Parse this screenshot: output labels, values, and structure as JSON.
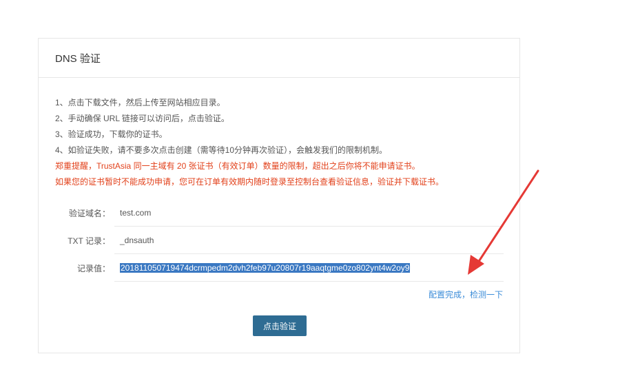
{
  "card": {
    "title": "DNS 验证",
    "instructions": [
      "1、点击下载文件，然后上传至网站相应目录。",
      "2、手动确保 URL 链接可以访问后，点击验证。",
      "3、验证成功，下载你的证书。",
      "4、如验证失败，请不要多次点击创建（需等待10分钟再次验证），会触发我们的限制机制。"
    ],
    "warnings": [
      "郑重提醒，TrustAsia 同一主域有 20 张证书（有效订单）数量的限制，超出之后你将不能申请证书。",
      "如果您的证书暂时不能成功申请，您可在订单有效期内随时登录至控制台查看验证信息，验证并下载证书。"
    ],
    "fields": {
      "domain_label": "验证域名：",
      "domain_value": "test.com",
      "txt_label": "TXT 记录：",
      "txt_value": "_dnsauth",
      "record_label": "记录值：",
      "record_value": "201811050719474dcrmpedm2dvh2feb97u20807r19aaqtgme0zo802ynt4w2oy9"
    },
    "check_link": "配置完成，检测一下",
    "verify_button": "点击验证"
  },
  "colors": {
    "warning": "#e2411b",
    "link": "#3b8cd8",
    "button": "#2e6c93",
    "selection": "#3a78c2",
    "annotation_arrow": "#e53935"
  }
}
